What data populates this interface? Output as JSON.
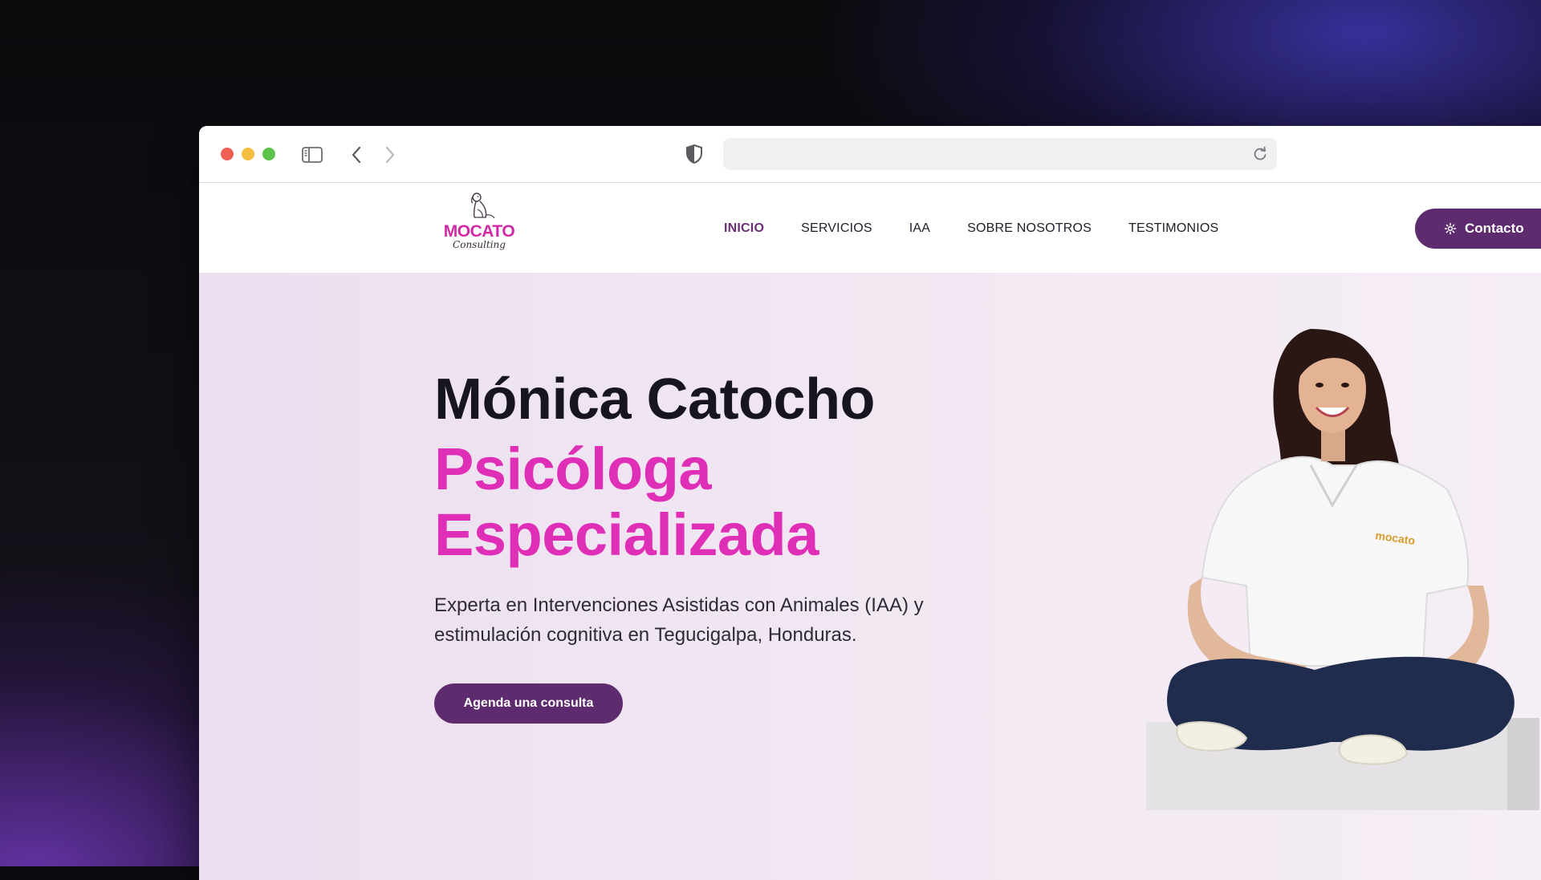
{
  "browser": {
    "url": "",
    "icons": [
      "sidebar-toggle-icon",
      "back-arrow-icon",
      "forward-arrow-icon",
      "shield-icon",
      "reload-icon"
    ]
  },
  "site": {
    "logo": {
      "wordmark": "MOCATO",
      "script": "Consulting"
    },
    "nav": [
      {
        "label": "INICIO",
        "active": true
      },
      {
        "label": "SERVICIOS",
        "active": false
      },
      {
        "label": "IAA",
        "active": false
      },
      {
        "label": "SOBRE NOSOTROS",
        "active": false
      },
      {
        "label": "TESTIMONIOS",
        "active": false
      }
    ],
    "contact_label": "Contacto"
  },
  "hero": {
    "name": "Mónica Catocho",
    "role_line1": "Psicóloga",
    "role_line2": "Especializada",
    "description": "Experta en Intervenciones Asistidas con Animales (IAA) y estimulación cognitiva en Tegucigalpa, Honduras.",
    "cta_label": "Agenda una consulta",
    "shirt_logo": "mocato"
  },
  "colors": {
    "brand_purple": "#5e2c6e",
    "brand_pink": "#df2fb7",
    "hero_bg": "#f1e7f2"
  }
}
